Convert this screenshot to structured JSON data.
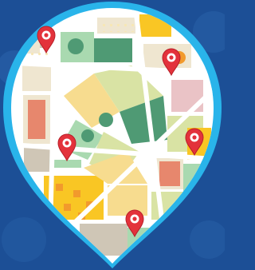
{
  "image": {
    "kind": "map-pin-illustration",
    "icon": "map-location-pin-icon",
    "pin_count": 5,
    "colors": {
      "background": "#1c4f96",
      "background_bubble": "#2a63aa",
      "pin_outline": "#29b4ea",
      "roads": "#ffffff",
      "park_green": "#d9e3a4",
      "dark_green": "#4f9a74",
      "sand": "#f7dc8f",
      "yellow": "#f9c624",
      "orange": "#f29a2c",
      "beige": "#efe6d0",
      "gray": "#cfc6b6",
      "salmon": "#e7876d",
      "pink": "#eac3c6",
      "marker_red": "#e3323b"
    }
  }
}
